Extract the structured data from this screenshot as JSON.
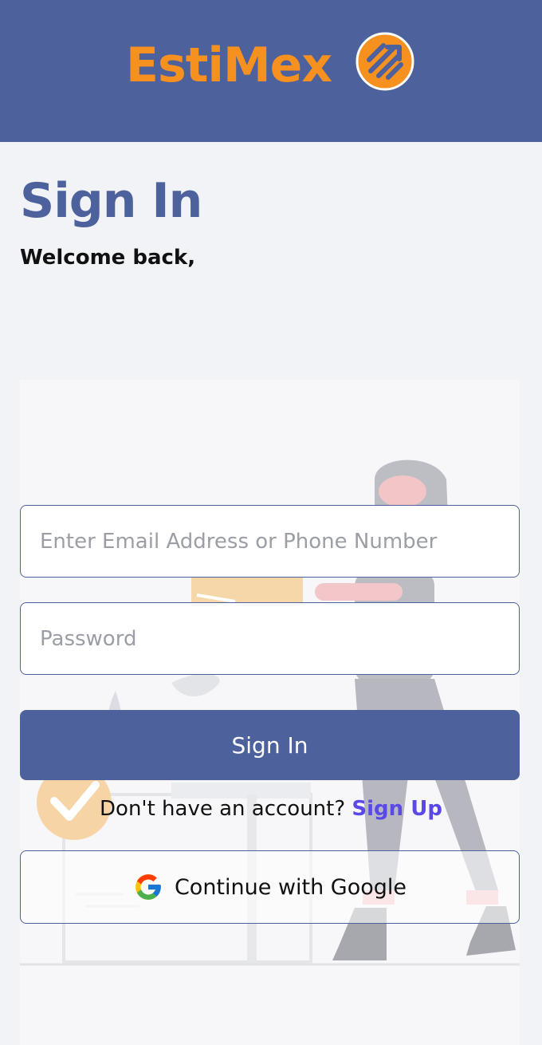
{
  "header": {
    "brand": "EstiMex",
    "brand_color": "#f6901f",
    "background": "#4d619c",
    "logo_icon": "trending-arrow-badge-icon"
  },
  "page": {
    "title": "Sign In",
    "subtitle": "Welcome back,"
  },
  "form": {
    "email_placeholder": "Enter Email Address or Phone Number",
    "email_value": "",
    "password_placeholder": "Password",
    "password_value": "",
    "submit_label": "Sign In"
  },
  "signup": {
    "prompt": "Don't have an account? ",
    "link": "Sign Up",
    "link_color": "#5a49e8"
  },
  "google": {
    "label": "Continue with Google",
    "icon": "google-g-icon"
  },
  "illustration": {
    "icon": "delivery-person-illustration"
  }
}
